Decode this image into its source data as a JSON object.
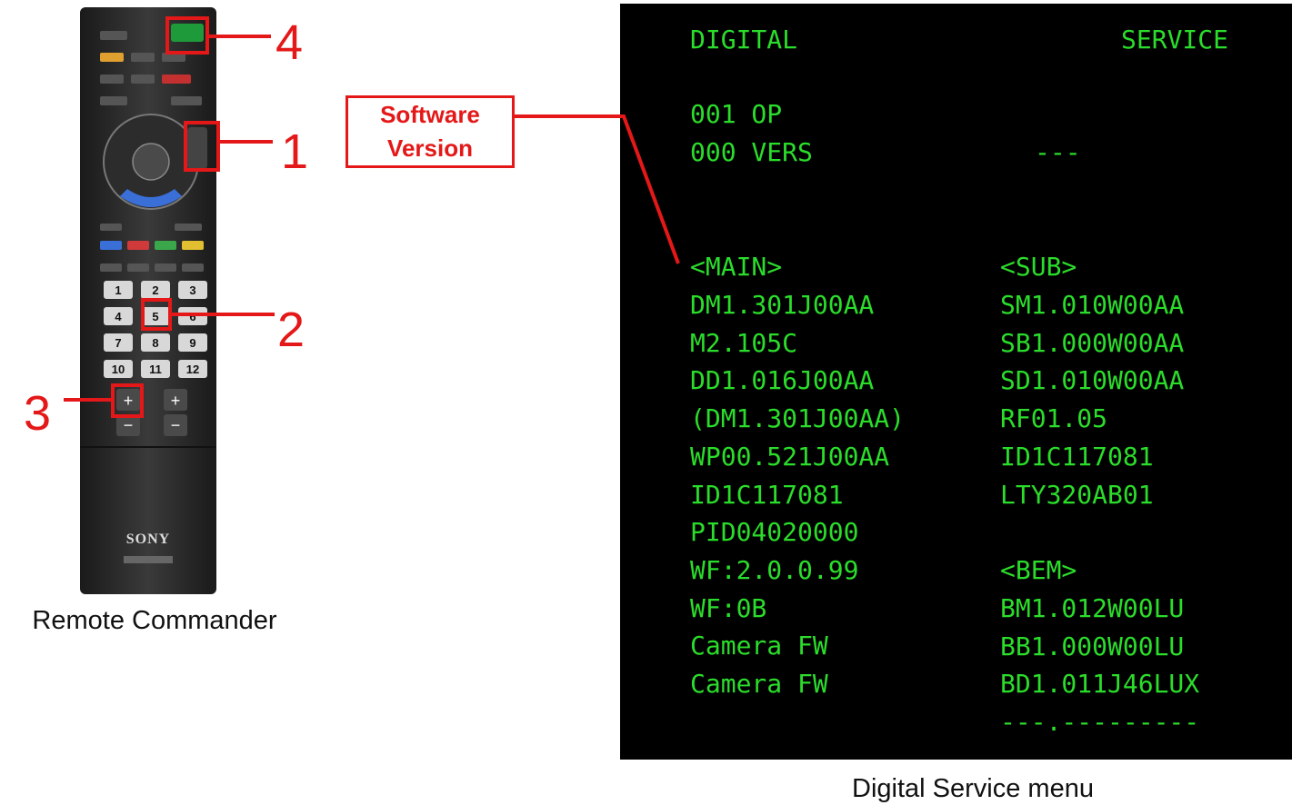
{
  "remote": {
    "caption": "Remote Commander",
    "brand": "SONY",
    "number_keys": [
      "1",
      "2",
      "3",
      "4",
      "5",
      "6",
      "7",
      "8",
      "9",
      "10",
      "11",
      "12"
    ],
    "plus_label": "+",
    "minus_label": "−",
    "callouts": [
      "1",
      "2",
      "3",
      "4"
    ],
    "colors": {
      "body": "#2a2a2a",
      "highlight": "#e41818",
      "key_blue": "#3a6fd8"
    }
  },
  "label": {
    "line1": "Software",
    "line2": "Version"
  },
  "screen": {
    "caption": "Digital Service menu",
    "header_left": "DIGITAL",
    "header_right": "SERVICE",
    "op_line": "001 OP",
    "vers_line": "000 VERS",
    "vers_value": "---",
    "main_title": "<MAIN>",
    "main_items": [
      "DM1.301J00AA",
      "M2.105C",
      "DD1.016J00AA",
      "(DM1.301J00AA)",
      "WP00.521J00AA",
      "ID1C117081",
      "PID04020000",
      "WF:2.0.0.99",
      "WF:0B",
      "Camera FW",
      "Camera FW"
    ],
    "sub_title": "<SUB>",
    "sub_items": [
      "SM1.010W00AA",
      "SB1.000W00AA",
      "SD1.010W00AA",
      "RF01.05",
      "ID1C117081",
      "LTY320AB01"
    ],
    "bem_title": "<BEM>",
    "bem_items": [
      "BM1.012W00LU",
      "BB1.000W00LU",
      "BD1.011J46LUX",
      "---.---------"
    ],
    "text_color": "#2bdd2b",
    "background": "#000000"
  }
}
